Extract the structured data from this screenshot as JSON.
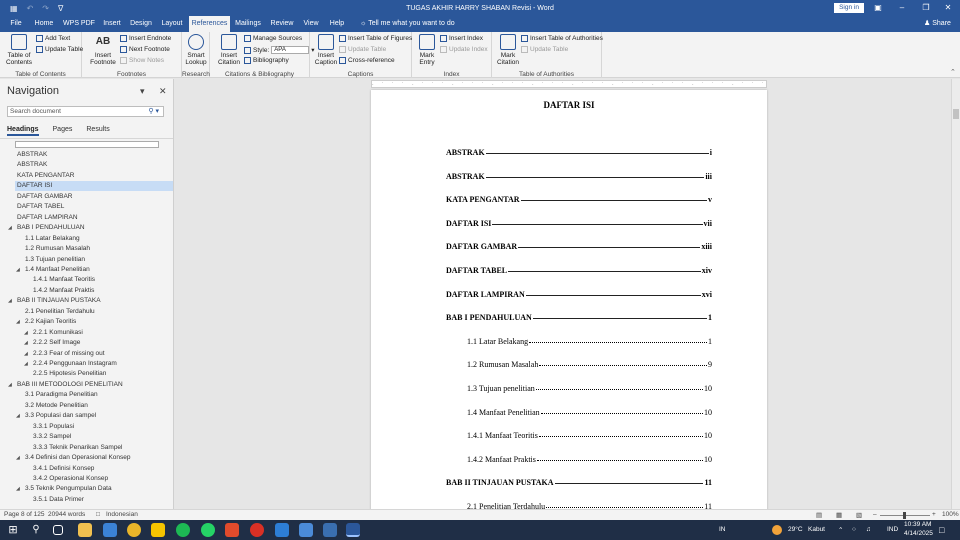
{
  "window": {
    "title": "TUGAS AKHIR HARRY SHABAN Revisi - Word",
    "signin": "Sign in",
    "tell_me": "Tell me what you want to do",
    "share": "Share"
  },
  "ribbon_tabs": [
    "File",
    "Home",
    "WPS PDF",
    "Insert",
    "Design",
    "Layout",
    "References",
    "Mailings",
    "Review",
    "View",
    "Help"
  ],
  "active_tab": "References",
  "ribbon": {
    "toc": {
      "big": "Table of Contents",
      "add_text": "Add Text",
      "update_table": "Update Table",
      "label": "Table of Contents"
    },
    "footnotes": {
      "insert_footnote": "Insert Footnote",
      "insert_endnote": "Insert Endnote",
      "next_footnote": "Next Footnote",
      "show_notes": "Show Notes",
      "label": "Footnotes",
      "ab_glyph": "AB"
    },
    "research": {
      "smart_lookup": "Smart Lookup",
      "label": "Research"
    },
    "citations": {
      "insert_citation": "Insert Citation",
      "manage_sources": "Manage Sources",
      "style_label": "Style:",
      "style_value": "APA",
      "bibliography": "Bibliography",
      "label": "Citations & Bibliography"
    },
    "captions": {
      "insert_caption": "Insert Caption",
      "insert_tof": "Insert Table of Figures",
      "update_table": "Update Table",
      "cross_reference": "Cross-reference",
      "label": "Captions"
    },
    "index": {
      "mark_entry": "Mark Entry",
      "insert_index": "Insert Index",
      "update_index": "Update Index",
      "label": "Index"
    },
    "toa": {
      "mark_citation": "Mark Citation",
      "insert_toa": "Insert Table of Authorities",
      "update_table": "Update Table",
      "label": "Table of Authorities"
    }
  },
  "navigation": {
    "title": "Navigation",
    "search_placeholder": "Search document",
    "tabs": [
      "Headings",
      "Pages",
      "Results"
    ],
    "active_tab": "Headings",
    "items": [
      {
        "text": "ABSTRAK",
        "level": 1,
        "toggle": false
      },
      {
        "text": "ABSTRAK",
        "level": 1,
        "toggle": false
      },
      {
        "text": "KATA PENGANTAR",
        "level": 1,
        "toggle": false
      },
      {
        "text": "DAFTAR ISI",
        "level": 1,
        "toggle": false,
        "selected": true
      },
      {
        "text": "DAFTAR GAMBAR",
        "level": 1,
        "toggle": false
      },
      {
        "text": "DAFTAR TABEL",
        "level": 1,
        "toggle": false
      },
      {
        "text": "DAFTAR LAMPIRAN",
        "level": 1,
        "toggle": false
      },
      {
        "text": "BAB I   PENDAHULUAN",
        "level": 1,
        "toggle": true
      },
      {
        "text": "1.1 Latar Belakang",
        "level": 2,
        "toggle": false
      },
      {
        "text": "1.2 Rumusan Masalah",
        "level": 2,
        "toggle": false
      },
      {
        "text": "1.3 Tujuan penelitian",
        "level": 2,
        "toggle": false
      },
      {
        "text": "1.4 Manfaat Penelitian",
        "level": 2,
        "toggle": true
      },
      {
        "text": "1.4.1 Manfaat Teoritis",
        "level": 3,
        "toggle": false
      },
      {
        "text": "1.4.2 Manfaat Praktis",
        "level": 3,
        "toggle": false
      },
      {
        "text": "BAB II   TINJAUAN PUSTAKA",
        "level": 1,
        "toggle": true
      },
      {
        "text": "2.1 Penelitian Terdahulu",
        "level": 2,
        "toggle": false
      },
      {
        "text": "2.2 Kajian Teoritis",
        "level": 2,
        "toggle": true
      },
      {
        "text": "2.2.1 Komunikasi",
        "level": 3,
        "toggle": true
      },
      {
        "text": "2.2.2  Self Image",
        "level": 3,
        "toggle": true
      },
      {
        "text": "2.2.3  Fear of missing out",
        "level": 3,
        "toggle": true
      },
      {
        "text": "2.2.4 Penggunaan Instagram",
        "level": 3,
        "toggle": true
      },
      {
        "text": "2.2.5 Hipotesis Penelitian",
        "level": 3,
        "toggle": false
      },
      {
        "text": "BAB III   METODOLOGI PENELITIAN",
        "level": 1,
        "toggle": true
      },
      {
        "text": "3.1 Paradigma Penelitian",
        "level": 2,
        "toggle": false
      },
      {
        "text": "3.2 Metode Penelitian",
        "level": 2,
        "toggle": false
      },
      {
        "text": "3.3 Populasi dan sampel",
        "level": 2,
        "toggle": true
      },
      {
        "text": "3.3.1 Populasi",
        "level": 3,
        "toggle": false
      },
      {
        "text": "3.3.2 Sampel",
        "level": 3,
        "toggle": false
      },
      {
        "text": "3.3.3 Teknik Penarikan Sampel",
        "level": 3,
        "toggle": false
      },
      {
        "text": "3.4 Definisi dan Operasional Konsep",
        "level": 2,
        "toggle": true
      },
      {
        "text": "3.4.1 Definisi Konsep",
        "level": 3,
        "toggle": false
      },
      {
        "text": "3.4.2 Operasional Konsep",
        "level": 3,
        "toggle": false
      },
      {
        "text": "3.5 Teknik Pengumpulan Data",
        "level": 2,
        "toggle": true
      },
      {
        "text": "3.5.1 Data Primer",
        "level": 3,
        "toggle": false
      }
    ]
  },
  "document": {
    "toc_title": "DAFTAR ISI",
    "entries": [
      {
        "label": "ABSTRAK",
        "page": "i",
        "bold": true,
        "indent": 0
      },
      {
        "label": "ABSTRAK",
        "page": "iii",
        "bold": true,
        "indent": 0
      },
      {
        "label": "KATA PENGANTAR",
        "page": "v",
        "bold": true,
        "indent": 0
      },
      {
        "label": "DAFTAR ISI",
        "page": "vii",
        "bold": true,
        "indent": 0
      },
      {
        "label": "DAFTAR GAMBAR",
        "page": "xiii",
        "bold": true,
        "indent": 0
      },
      {
        "label": "DAFTAR TABEL",
        "page": "xiv",
        "bold": true,
        "indent": 0
      },
      {
        "label": "DAFTAR LAMPIRAN",
        "page": "xvi",
        "bold": true,
        "indent": 0
      },
      {
        "label": "BAB I PENDAHULUAN",
        "page": "1",
        "bold": true,
        "indent": 0
      },
      {
        "label": "1.1 Latar Belakang",
        "page": "1",
        "bold": false,
        "indent": 1
      },
      {
        "label": "1.2 Rumusan Masalah",
        "page": "9",
        "bold": false,
        "indent": 1
      },
      {
        "label": "1.3 Tujuan penelitian",
        "page": "10",
        "bold": false,
        "indent": 1
      },
      {
        "label": "1.4 Manfaat Penelitian",
        "page": "10",
        "bold": false,
        "indent": 1
      },
      {
        "label": "1.4.1 Manfaat Teoritis",
        "page": "10",
        "bold": false,
        "indent": 1
      },
      {
        "label": "1.4.2 Manfaat Praktis",
        "page": "10",
        "bold": false,
        "indent": 1
      },
      {
        "label": "BAB II TINJAUAN PUSTAKA",
        "page": "11",
        "bold": true,
        "indent": 0
      },
      {
        "label": "2.1 Penelitian Terdahulu",
        "page": "11",
        "bold": false,
        "indent": 1
      }
    ]
  },
  "status": {
    "page": "Page 8 of 125",
    "words": "20944 words",
    "language": "Indonesian",
    "zoom": "100%"
  },
  "taskbar": {
    "lang": "IN",
    "weather_temp": "29°C",
    "weather_desc": "Kabut",
    "ime": "IND",
    "time": "10:39 AM",
    "date": "4/14/2025"
  },
  "colors": {
    "accent": "#2b579a",
    "selection": "#c7dcf5",
    "taskbar": "#1f2e46"
  }
}
